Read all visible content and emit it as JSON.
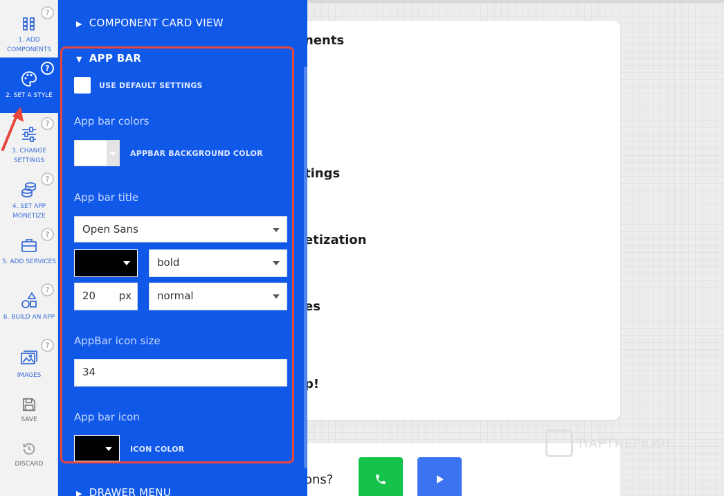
{
  "sidebar": {
    "items": [
      {
        "label": "1. ADD COMPONENTS",
        "icon": "grid-icon",
        "help": "?"
      },
      {
        "label": "2. SET A STYLE",
        "icon": "palette-icon",
        "help": "?"
      },
      {
        "label": "3. CHANGE SETTINGS",
        "icon": "sliders-icon",
        "help": "?"
      },
      {
        "label": "4. SET APP MONETIZE",
        "icon": "coins-icon",
        "help": "?"
      },
      {
        "label": "5. ADD SERVICES",
        "icon": "briefcase-icon",
        "help": "?"
      },
      {
        "label": "6. BUILD AN APP",
        "icon": "shapes-icon",
        "help": "?"
      },
      {
        "label": "IMAGES",
        "icon": "images-icon",
        "help": "?"
      },
      {
        "label": "SAVE",
        "icon": "floppy-icon"
      },
      {
        "label": "DISCARD",
        "icon": "history-icon"
      }
    ]
  },
  "panel": {
    "section_card_view": "COMPONENT CARD VIEW",
    "section_app_bar": "APP BAR",
    "use_default": "USE DEFAULT SETTINGS",
    "colors_label": "App bar colors",
    "bg_color_label": "APPBAR BACKGROUND COLOR",
    "title_label": "App bar title",
    "font_family": "Open Sans",
    "font_weight": "bold",
    "font_size": "20",
    "font_size_unit": "px",
    "font_style": "normal",
    "icon_size_label": "AppBar icon size",
    "icon_size_value": "34",
    "icon_label": "App bar icon",
    "icon_color_label": "ICON COLOR",
    "section_drawer": "DRAWER MENU"
  },
  "content": {
    "line1": "nents",
    "line2": "tings",
    "line3": "etization",
    "line4": "es",
    "line5": "p!",
    "bottom_question": "ons?"
  },
  "watermark": "ПАРТНЕРКИН",
  "colors": {
    "panel_blue": "#1058e8",
    "highlight_red": "#e6463c",
    "call_green": "#15c24a",
    "play_blue": "#3b73f0"
  }
}
